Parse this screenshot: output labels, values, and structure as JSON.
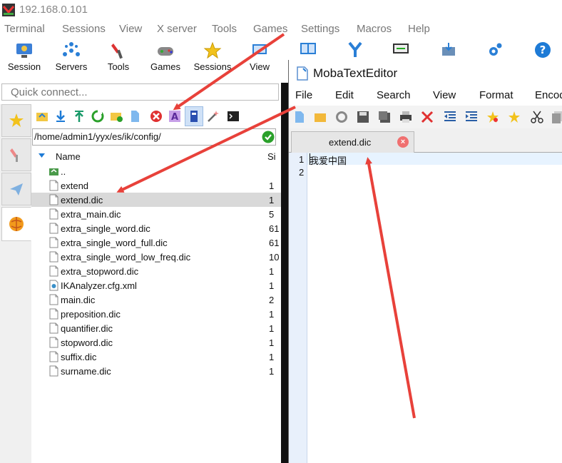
{
  "window": {
    "title": "192.168.0.101"
  },
  "menubar": [
    "Terminal",
    "Sessions",
    "View",
    "X server",
    "Tools",
    "Games",
    "Settings",
    "Macros",
    "Help"
  ],
  "toolbar": [
    {
      "label": "Session",
      "icon": "session-icon"
    },
    {
      "label": "Servers",
      "icon": "servers-icon"
    },
    {
      "label": "Tools",
      "icon": "tools-icon"
    },
    {
      "label": "Games",
      "icon": "games-icon"
    },
    {
      "label": "Sessions",
      "icon": "sessions-star-icon"
    },
    {
      "label": "View",
      "icon": "view-icon"
    }
  ],
  "quick_connect": {
    "placeholder": "Quick connect..."
  },
  "sftp": {
    "path": "/home/admin1/yyx/es/ik/config/",
    "columns": {
      "name": "Name",
      "size": "Si"
    },
    "files": [
      {
        "name": "..",
        "size": "",
        "type": "parent"
      },
      {
        "name": "extend",
        "size": "1",
        "type": "file"
      },
      {
        "name": "extend.dic",
        "size": "1",
        "type": "file",
        "selected": true
      },
      {
        "name": "extra_main.dic",
        "size": "5",
        "type": "file"
      },
      {
        "name": "extra_single_word.dic",
        "size": "61",
        "type": "file"
      },
      {
        "name": "extra_single_word_full.dic",
        "size": "61",
        "type": "file"
      },
      {
        "name": "extra_single_word_low_freq.dic",
        "size": "10",
        "type": "file"
      },
      {
        "name": "extra_stopword.dic",
        "size": "1",
        "type": "file"
      },
      {
        "name": "IKAnalyzer.cfg.xml",
        "size": "1",
        "type": "xml"
      },
      {
        "name": "main.dic",
        "size": "2",
        "type": "file"
      },
      {
        "name": "preposition.dic",
        "size": "1",
        "type": "file"
      },
      {
        "name": "quantifier.dic",
        "size": "1",
        "type": "file"
      },
      {
        "name": "stopword.dic",
        "size": "1",
        "type": "file"
      },
      {
        "name": "suffix.dic",
        "size": "1",
        "type": "file"
      },
      {
        "name": "surname.dic",
        "size": "1",
        "type": "file"
      }
    ]
  },
  "editor": {
    "title": "MobaTextEditor",
    "menu": [
      "File",
      "Edit",
      "Search",
      "View",
      "Format",
      "Encod"
    ],
    "tab": {
      "label": "extend.dic",
      "close": "×"
    },
    "lines": [
      "我爱中国",
      ""
    ],
    "line_numbers": [
      "1",
      "2"
    ]
  },
  "colors": {
    "arrow": "#e8413a",
    "accent": "#1e7bd6",
    "selection": "#d9d9d9"
  }
}
